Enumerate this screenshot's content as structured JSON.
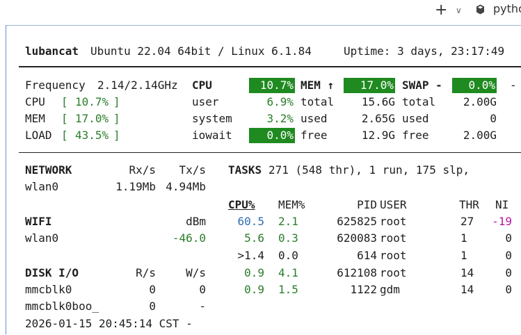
{
  "tabbar": {
    "new_tab_symbol": "+",
    "dropdown_symbol": "∨",
    "tab_label": "pytho"
  },
  "header": {
    "hostname": "lubancat",
    "os": "Ubuntu 22.04 64bit / Linux 6.1.84",
    "uptime": "Uptime: 3 days, 23:17:49"
  },
  "quicklook": {
    "freq_label": "Frequency",
    "freq_value": "2.14/2.14GHz",
    "cpu_label": "CPU",
    "cpu_lb": "[",
    "cpu_value": "10.7%",
    "cpu_rb": "]",
    "mem_label": "MEM",
    "mem_lb": "[",
    "mem_value": "17.0%",
    "mem_rb": "]",
    "load_label": "LOAD",
    "load_lb": "[",
    "load_value": "43.5%",
    "load_rb": "]"
  },
  "cpu": {
    "title": "CPU",
    "total": "10.7%",
    "user_label": "user",
    "user": "6.9%",
    "system_label": "system",
    "system": "3.2%",
    "iowait_label": "iowait",
    "iowait": "0.0%"
  },
  "mem": {
    "title": "MEM ↑",
    "percent": "17.0%",
    "total_label": "total",
    "total": "15.6G",
    "used_label": "used",
    "used": "2.65G",
    "free_label": "free",
    "free": "12.9G"
  },
  "swap": {
    "title": "SWAP -",
    "percent": "0.0%",
    "trailing": "-",
    "total_label": "total",
    "total": "2.00G",
    "used_label": "used",
    "used": "0",
    "free_label": "free",
    "free": "2.00G"
  },
  "network": {
    "title": "NETWORK",
    "rx_header": "Rx/s",
    "tx_header": "Tx/s",
    "iface": "wlan0",
    "rx": "1.19Mb",
    "tx": "4.94Mb"
  },
  "wifi": {
    "title": "WIFI",
    "unit": "dBm",
    "iface": "wlan0",
    "signal": "-46.0"
  },
  "disk": {
    "title": "DISK I/O",
    "r_header": "R/s",
    "w_header": "W/s",
    "rows": [
      {
        "name": "mmcblk0",
        "r": "0",
        "w": "0"
      },
      {
        "name": "mmcblk0boo_",
        "r": "0",
        "w": "-"
      }
    ]
  },
  "tasks": {
    "title": "TASKS",
    "summary": "271 (548 thr), 1 run, 175 slp,"
  },
  "process_table": {
    "headers": {
      "cpu": "CPU%",
      "mem": "MEM%",
      "pid": "PID",
      "user": "USER",
      "thr": "THR",
      "ni": "NI"
    },
    "rows": [
      {
        "cpu": "60.5",
        "mem": "2.1",
        "pid": "625825",
        "user": "root",
        "thr": "27",
        "ni": "-19"
      },
      {
        "cpu": "5.6",
        "mem": "0.3",
        "pid": "620083",
        "user": "root",
        "thr": "1",
        "ni": "0"
      },
      {
        "cpu": ">1.4",
        "mem": "0.0",
        "pid": "614",
        "user": "root",
        "thr": "1",
        "ni": "0"
      },
      {
        "cpu": "0.9",
        "mem": "4.1",
        "pid": "612108",
        "user": "root",
        "thr": "14",
        "ni": "0"
      },
      {
        "cpu": "0.9",
        "mem": "1.5",
        "pid": "1122",
        "user": "gdm",
        "thr": "14",
        "ni": "0"
      }
    ]
  },
  "footer": {
    "datetime": "2026-01-15 20:45:14 CST -"
  },
  "colors": {
    "highlight_bg": "#1f8a1f",
    "ok_green": "#2a7d2a",
    "cpu_blue": "#2f6db5",
    "nice_magenta": "#b5179e"
  }
}
